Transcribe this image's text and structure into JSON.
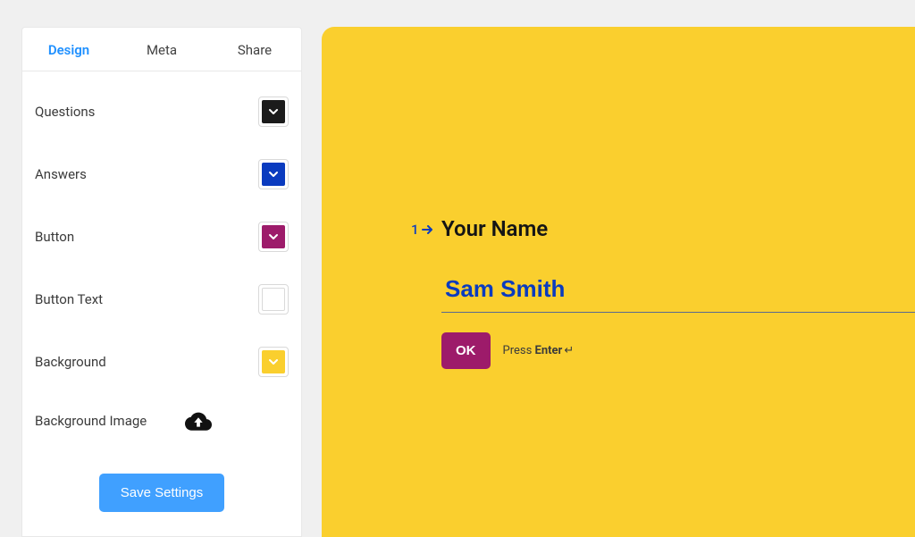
{
  "sidebar": {
    "tabs": [
      {
        "label": "Design",
        "active": true
      },
      {
        "label": "Meta",
        "active": false
      },
      {
        "label": "Share",
        "active": false
      }
    ],
    "options": {
      "questions": {
        "label": "Questions",
        "color": "#1b1b1b",
        "chevron": "#ffffff"
      },
      "answers": {
        "label": "Answers",
        "color": "#0a3bbf",
        "chevron": "#ffffff"
      },
      "button": {
        "label": "Button",
        "color": "#9d1b6a",
        "chevron": "#ffffff"
      },
      "button_text": {
        "label": "Button Text",
        "color": "#ffffff",
        "chevron": null
      },
      "background": {
        "label": "Background",
        "color": "#facf2e",
        "chevron": "#ffffff"
      }
    },
    "bg_image_label": "Background Image",
    "save_label": "Save Settings"
  },
  "preview": {
    "question_number": "1",
    "question_text": "Your Name",
    "answer_value": "Sam Smith",
    "ok_label": "OK",
    "hint_press": "Press ",
    "hint_key": "Enter",
    "hint_glyph": "↵"
  }
}
